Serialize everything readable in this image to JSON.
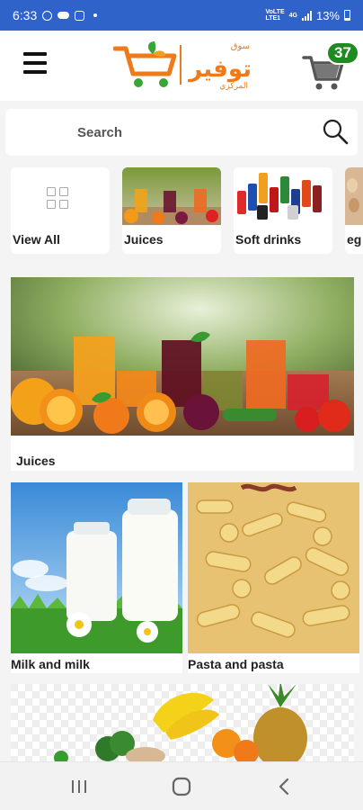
{
  "status_bar": {
    "time": "6:33",
    "network_top": "VoLTE",
    "network_bottom": "LTE1",
    "signal_tag": "4G",
    "battery": "13%"
  },
  "header": {
    "menu_icon": "hamburger-menu-icon",
    "logo": {
      "text_top": "سوق",
      "text_main": "توفير",
      "text_bottom": "المركزي",
      "cart_color": "#f07a1a",
      "leaf_color": "#3aa537"
    },
    "cart_icon": "shopping-cart-icon",
    "cart_count": "37",
    "badge_color": "#1f8a1f"
  },
  "search": {
    "placeholder": "Search",
    "icon": "search-icon"
  },
  "categories": [
    {
      "label": "View All",
      "icon": "grid-icon"
    },
    {
      "label": "Juices"
    },
    {
      "label": "Soft drinks"
    },
    {
      "label": "eg"
    }
  ],
  "featured": [
    {
      "title": "Juices"
    },
    {
      "title": "Milk and milk"
    },
    {
      "title": "Pasta and pasta"
    }
  ],
  "bottom_nav": {
    "recents_icon": "recents-icon",
    "home_icon": "home-icon",
    "back_icon": "back-icon"
  },
  "colors": {
    "status_bar": "#2f63c9",
    "accent_orange": "#f07a1a"
  }
}
